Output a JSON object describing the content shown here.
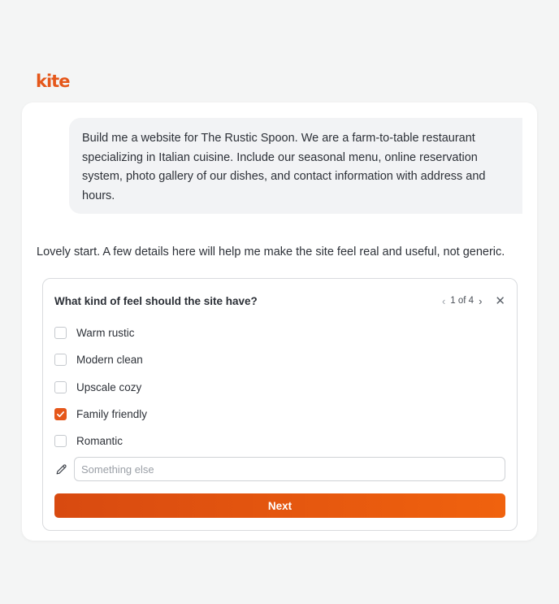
{
  "brand": {
    "logo_text": "kite",
    "color": "#e5571a"
  },
  "chat": {
    "user_message": "Build me a website for The Rustic Spoon. We are a farm-to-table restaurant specializing in Italian cuisine. Include our seasonal menu, online reservation system, photo gallery of our dishes, and contact information with address and hours.",
    "assistant_reply": "Lovely start. A few details here will help me make the site feel real and useful, not generic."
  },
  "question": {
    "title": "What kind of feel should the site have?",
    "pager": "1 of 4",
    "options": [
      {
        "label": "Warm rustic",
        "checked": false
      },
      {
        "label": "Modern clean",
        "checked": false
      },
      {
        "label": "Upscale cozy",
        "checked": false
      },
      {
        "label": "Family friendly",
        "checked": true
      },
      {
        "label": "Romantic",
        "checked": false
      }
    ],
    "other_placeholder": "Something else",
    "other_value": "",
    "next_label": "Next"
  },
  "icons": {
    "prev": "chevron-left-icon",
    "next": "chevron-right-icon",
    "close": "close-icon",
    "pencil": "pencil-icon",
    "check": "check-icon"
  }
}
